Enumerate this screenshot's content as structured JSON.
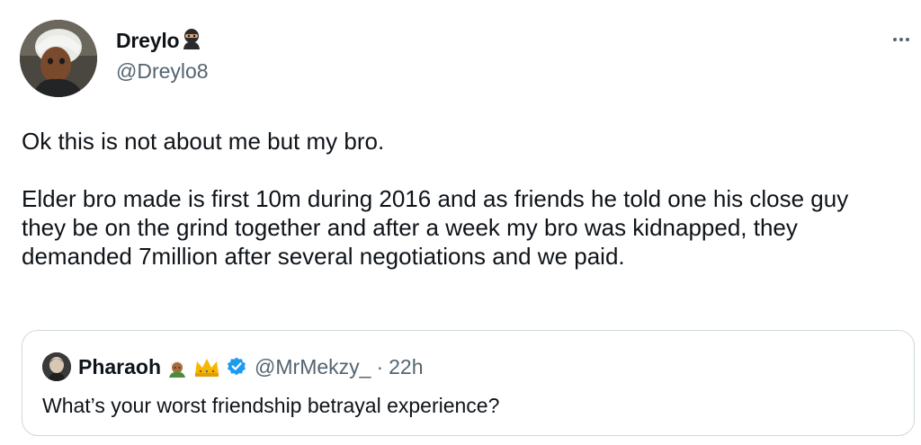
{
  "tweet": {
    "author": {
      "display_name": "Dreylo",
      "name_emoji": "ninja-emoji",
      "handle": "@Dreylo8"
    },
    "more_icon": "more-horizontal-icon",
    "paragraphs": [
      "Ok this is not about me but my bro.",
      "Elder bro made is first 10m during 2016 and as friends he told one his close guy they be on the grind together and after a week my bro was kidnapped, they  demanded 7million after several negotiations and we paid."
    ],
    "quote": {
      "display_name": "Pharaoh",
      "emojis": [
        "man-with-turban-emoji",
        "crown-emoji"
      ],
      "verified_icon": "verified-badge-icon",
      "handle": "@MrMekzy_",
      "separator": "·",
      "time": "22h",
      "text": "What’s your worst friendship betrayal experience?"
    }
  },
  "colors": {
    "text": "#0f1419",
    "secondary": "#536471",
    "border": "#cfd9de",
    "verified": "#1d9bf0",
    "crown": "#f5b800"
  }
}
